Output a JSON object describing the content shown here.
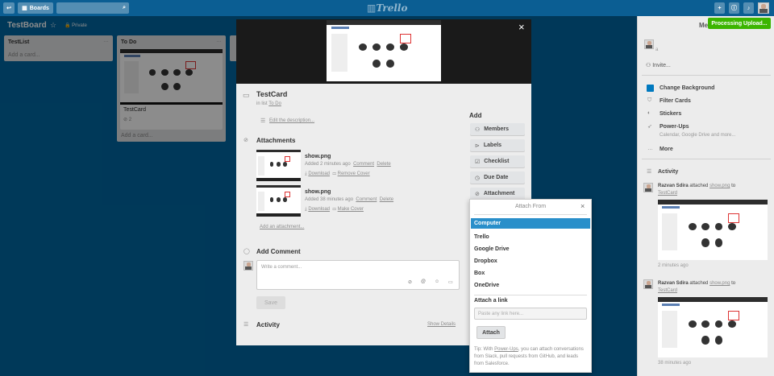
{
  "header": {
    "boards_label": "Boards",
    "logo": "Trello"
  },
  "board": {
    "title": "TestBoard",
    "visibility": "Private"
  },
  "lists": [
    {
      "title": "TestList",
      "add": "Add a card..."
    },
    {
      "title": "To Do",
      "card_title": "TestCard",
      "badge": "2",
      "add": "Add a card..."
    }
  ],
  "card": {
    "title": "TestCard",
    "in_list_prefix": "in list",
    "in_list_name": "To Do",
    "edit_description": "Edit the description...",
    "attachments_title": "Attachments",
    "attachments": [
      {
        "name": "show.png",
        "added": "Added 2 minutes ago",
        "comment": "Comment",
        "delete": "Delete",
        "download": "Download",
        "cover_action": "Remove Cover"
      },
      {
        "name": "show.png",
        "added": "Added 38 minutes ago",
        "comment": "Comment",
        "delete": "Delete",
        "download": "Download",
        "cover_action": "Make Cover"
      }
    ],
    "add_attachment": "Add an attachment...",
    "add_comment_title": "Add Comment",
    "comment_placeholder": "Write a comment...",
    "save": "Save",
    "activity_title": "Activity",
    "show_details": "Show Details"
  },
  "add_panel": {
    "title": "Add",
    "buttons": [
      "Members",
      "Labels",
      "Checklist",
      "Due Date",
      "Attachment"
    ]
  },
  "attach_popup": {
    "title": "Attach From",
    "close": "×",
    "options": [
      "Computer",
      "Trello",
      "Google Drive",
      "Dropbox",
      "Box",
      "OneDrive"
    ],
    "attach_link_label": "Attach a link",
    "link_placeholder": "Paste any link here...",
    "attach_button": "Attach",
    "tip_prefix": "Tip: With",
    "tip_link": "Power-Ups",
    "tip_rest": ", you can attach conversations from Slack, pull requests from GitHub, and leads from Salesforce."
  },
  "sidebar": {
    "title": "Me",
    "invite": "Invite...",
    "menu": [
      "Change Background",
      "Filter Cards",
      "Stickers",
      "Power-Ups"
    ],
    "powerups_sub": "Calendar, Google Drive and more...",
    "more": "More",
    "activity_title": "Activity",
    "activity": [
      {
        "user": "Razvan Sdira",
        "verb": "attached",
        "file": "show.png",
        "to": "to",
        "card": "TestCard",
        "time": "2 minutes ago"
      },
      {
        "user": "Razvan Sdira",
        "verb": "attached",
        "file": "show.png",
        "to": "to",
        "card": "TestCard",
        "time": "38 minutes ago"
      }
    ]
  },
  "processing_label": "Processing Upload...",
  "colors": {
    "board_bg": "#0067a3",
    "header_bg": "#0b5e93",
    "selected_option": "#298fca",
    "processing": "#3cb500"
  }
}
